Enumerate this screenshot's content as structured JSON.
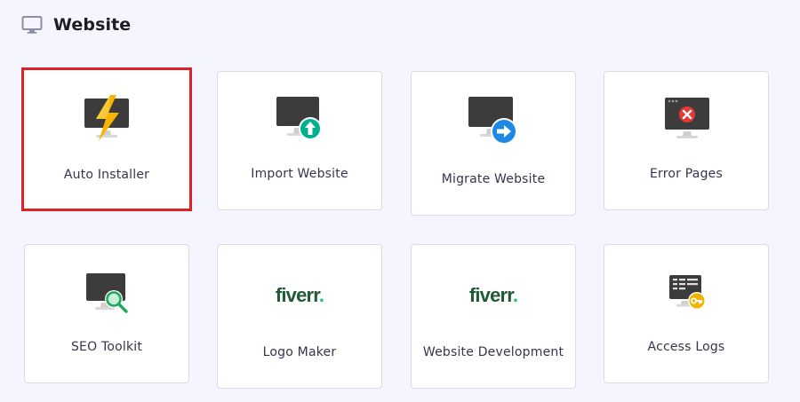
{
  "section": {
    "title": "Website",
    "icon": "monitor-icon"
  },
  "cards": [
    {
      "label": "Auto Installer",
      "icon": "monitor-lightning-icon",
      "highlighted": true
    },
    {
      "label": "Import Website",
      "icon": "monitor-upload-icon"
    },
    {
      "label": "Migrate Website",
      "icon": "monitor-arrow-right-icon"
    },
    {
      "label": "Error Pages",
      "icon": "monitor-error-icon"
    },
    {
      "label": "SEO Toolkit",
      "icon": "monitor-search-icon"
    },
    {
      "label": "Logo Maker",
      "icon": "fiverr-logo",
      "brand": "fiverr"
    },
    {
      "label": "Website Development",
      "icon": "fiverr-logo",
      "brand": "fiverr"
    },
    {
      "label": "Access Logs",
      "icon": "server-key-icon"
    }
  ],
  "colors": {
    "background": "#f4f5ff",
    "highlight_border": "#e01f26",
    "fiverr_text": "#1f5a37",
    "fiverr_dot": "#1dbf73",
    "upload_badge": "#00b090",
    "migrate_badge": "#1e88e5",
    "error_badge": "#e53935",
    "lightning": "#f7b500",
    "key_badge": "#f2b200"
  }
}
